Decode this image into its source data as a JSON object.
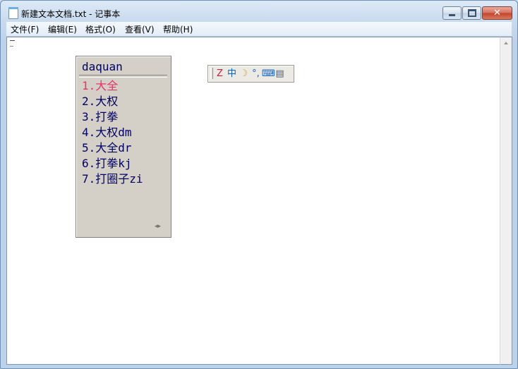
{
  "window": {
    "title": "新建文本文档.txt - 记事本",
    "close_glyph": "✕"
  },
  "menu": {
    "items": [
      "文件(F)",
      "编辑(E)",
      "格式(O)",
      "查看(V)",
      "帮助(H)"
    ]
  },
  "ime": {
    "pinyin": "daquan",
    "candidates": [
      "1.大全",
      "2.大权",
      "3.打拳",
      "4.大权dm",
      "5.大全dr",
      "6.打拳kj",
      "7.打圈子zi"
    ],
    "selected_index": 0,
    "pager": "◂▸",
    "toolbar_icons": [
      {
        "name": "ime-logo-icon",
        "glyph": "Z",
        "color": "#c02040"
      },
      {
        "name": "chinese-mode-icon",
        "glyph": "中",
        "color": "#1060c0"
      },
      {
        "name": "half-width-moon-icon",
        "glyph": "☽",
        "color": "#e0a000"
      },
      {
        "name": "punctuation-icon",
        "glyph": "°,",
        "color": "#1060c0"
      },
      {
        "name": "soft-keyboard-icon",
        "glyph": "⌨",
        "color": "#1060c0"
      },
      {
        "name": "settings-menu-icon",
        "glyph": "▤",
        "color": "#506070"
      }
    ]
  },
  "colors": {
    "candidate_text": "#000066",
    "candidate_selected": "#e53366"
  }
}
